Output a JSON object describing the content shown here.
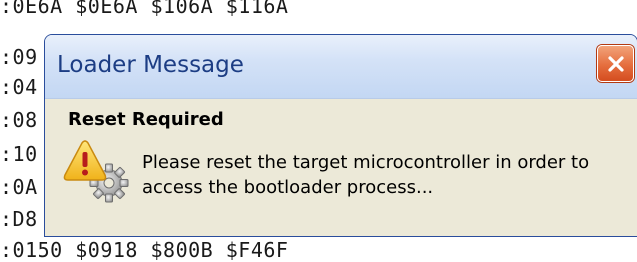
{
  "background": {
    "top_line": ":0E6A $0E6A $106A $116A",
    "side_lines": [
      ":09",
      ":04",
      ":08",
      ":10",
      ":0A",
      ":D8"
    ],
    "bottom_line": ":0150 $0918 $800B $F46F"
  },
  "dialog": {
    "title": "Loader Message",
    "heading": "Reset Required",
    "message_line1": "Please reset the target microcontroller in order to",
    "message_line2": "access the bootloader process...",
    "icons": {
      "close": "close-icon",
      "warning": "warning-gear-icon"
    },
    "colors": {
      "title_text": "#1c3d84",
      "close_button": "#e56e3e",
      "dialog_body": "#ece9d8"
    }
  }
}
